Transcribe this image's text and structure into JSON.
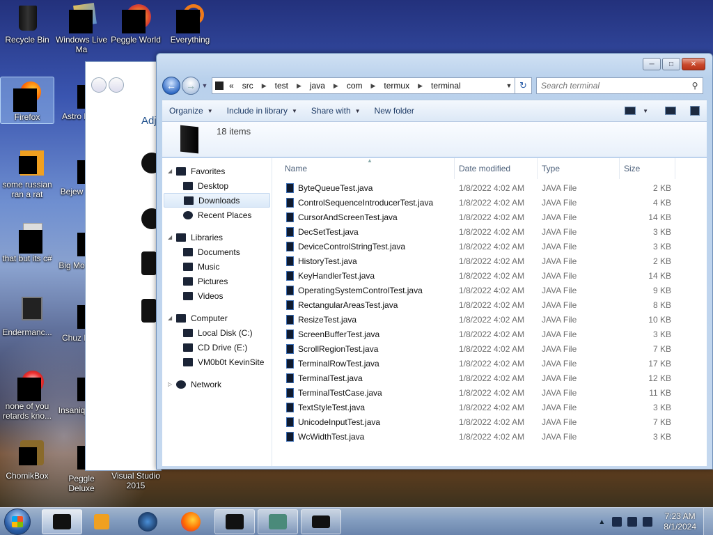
{
  "desktop": {
    "icons": [
      {
        "label": "Recycle Bin"
      },
      {
        "label": "Windows Live Ma"
      },
      {
        "label": "Peggle World"
      },
      {
        "label": "Everything"
      },
      {
        "label": "Firefox"
      },
      {
        "label": "Astro Delu"
      },
      {
        "label": "some russian ran a rat"
      },
      {
        "label": "Bejew Delu"
      },
      {
        "label": "that but its c#"
      },
      {
        "label": "Big Mo Delu"
      },
      {
        "label": "Endermanc..."
      },
      {
        "label": "Chuz Delu"
      },
      {
        "label": "none of you retards kno..."
      },
      {
        "label": "Insaniq Delu"
      },
      {
        "label": "ChomikBox"
      },
      {
        "label": "Peggle Deluxe"
      },
      {
        "label": "Visual Studio 2015"
      }
    ]
  },
  "back_window": {
    "title_partial": "Adj"
  },
  "explorer": {
    "breadcrumb_prefix": "«",
    "breadcrumb": [
      "src",
      "test",
      "java",
      "com",
      "termux",
      "terminal"
    ],
    "search_placeholder": "Search terminal",
    "toolbar": {
      "organize": "Organize",
      "include_in_library": "Include in library",
      "share_with": "Share with",
      "new_folder": "New folder"
    },
    "item_count": "18 items",
    "nav": {
      "favorites": "Favorites",
      "desktop": "Desktop",
      "downloads": "Downloads",
      "recent_places": "Recent Places",
      "libraries": "Libraries",
      "documents": "Documents",
      "music": "Music",
      "pictures": "Pictures",
      "videos": "Videos",
      "computer": "Computer",
      "local_disk": "Local Disk (C:)",
      "cd_drive": "CD Drive (E:)",
      "vm_share": "VM0b0t KevinSite",
      "network": "Network"
    },
    "columns": {
      "name": "Name",
      "date": "Date modified",
      "type": "Type",
      "size": "Size"
    },
    "files": [
      {
        "name": "ByteQueueTest.java",
        "date": "1/8/2022 4:02 AM",
        "type": "JAVA File",
        "size": "2 KB"
      },
      {
        "name": "ControlSequenceIntroducerTest.java",
        "date": "1/8/2022 4:02 AM",
        "type": "JAVA File",
        "size": "4 KB"
      },
      {
        "name": "CursorAndScreenTest.java",
        "date": "1/8/2022 4:02 AM",
        "type": "JAVA File",
        "size": "14 KB"
      },
      {
        "name": "DecSetTest.java",
        "date": "1/8/2022 4:02 AM",
        "type": "JAVA File",
        "size": "3 KB"
      },
      {
        "name": "DeviceControlStringTest.java",
        "date": "1/8/2022 4:02 AM",
        "type": "JAVA File",
        "size": "3 KB"
      },
      {
        "name": "HistoryTest.java",
        "date": "1/8/2022 4:02 AM",
        "type": "JAVA File",
        "size": "2 KB"
      },
      {
        "name": "KeyHandlerTest.java",
        "date": "1/8/2022 4:02 AM",
        "type": "JAVA File",
        "size": "14 KB"
      },
      {
        "name": "OperatingSystemControlTest.java",
        "date": "1/8/2022 4:02 AM",
        "type": "JAVA File",
        "size": "9 KB"
      },
      {
        "name": "RectangularAreasTest.java",
        "date": "1/8/2022 4:02 AM",
        "type": "JAVA File",
        "size": "8 KB"
      },
      {
        "name": "ResizeTest.java",
        "date": "1/8/2022 4:02 AM",
        "type": "JAVA File",
        "size": "10 KB"
      },
      {
        "name": "ScreenBufferTest.java",
        "date": "1/8/2022 4:02 AM",
        "type": "JAVA File",
        "size": "3 KB"
      },
      {
        "name": "ScrollRegionTest.java",
        "date": "1/8/2022 4:02 AM",
        "type": "JAVA File",
        "size": "7 KB"
      },
      {
        "name": "TerminalRowTest.java",
        "date": "1/8/2022 4:02 AM",
        "type": "JAVA File",
        "size": "17 KB"
      },
      {
        "name": "TerminalTest.java",
        "date": "1/8/2022 4:02 AM",
        "type": "JAVA File",
        "size": "12 KB"
      },
      {
        "name": "TerminalTestCase.java",
        "date": "1/8/2022 4:02 AM",
        "type": "JAVA File",
        "size": "11 KB"
      },
      {
        "name": "TextStyleTest.java",
        "date": "1/8/2022 4:02 AM",
        "type": "JAVA File",
        "size": "3 KB"
      },
      {
        "name": "UnicodeInputTest.java",
        "date": "1/8/2022 4:02 AM",
        "type": "JAVA File",
        "size": "7 KB"
      },
      {
        "name": "WcWidthTest.java",
        "date": "1/8/2022 4:02 AM",
        "type": "JAVA File",
        "size": "3 KB"
      }
    ]
  },
  "taskbar": {
    "time": "7:23 AM",
    "date": "8/1/2024"
  }
}
